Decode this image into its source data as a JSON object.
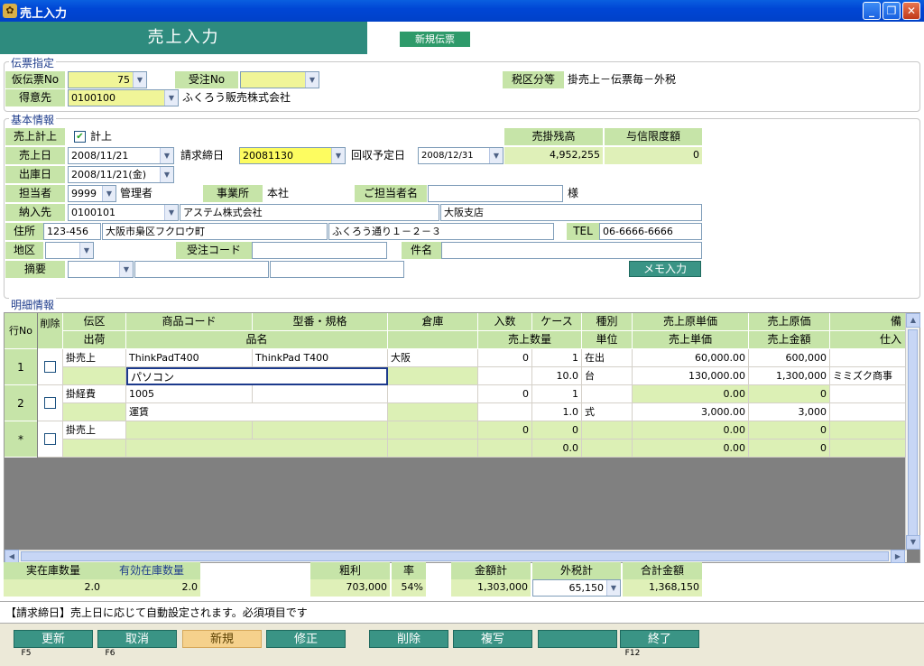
{
  "window": {
    "title": "売上入力"
  },
  "header": {
    "title": "売上入力",
    "new_slip": "新規伝票"
  },
  "slip": {
    "legend": "伝票指定",
    "temp_no_label": "仮伝票No",
    "temp_no": "75",
    "order_no_label": "受注No",
    "order_no": "",
    "tax_label": "税区分等",
    "tax_value": "掛売上－伝票毎－外税",
    "customer_label": "得意先",
    "customer_code": "0100100",
    "customer_name": "ふくろう販売株式会社"
  },
  "basic": {
    "legend": "基本情報",
    "sales_record_label": "売上計上",
    "sales_record_check": "計上",
    "sales_date_label": "売上日",
    "sales_date": "2008/11/21",
    "billing_date_label": "請求締日",
    "billing_date": "20081130",
    "collect_label": "回収予定日",
    "collect_date": "2008/12/31",
    "balance_label": "売掛残高",
    "balance": "4,952,255",
    "credit_label": "与信限度額",
    "credit": "0",
    "ship_date_label": "出庫日",
    "ship_date": "2008/11/21(金)",
    "staff_label": "担当者",
    "staff_code": "9999",
    "staff_name": "管理者",
    "office_label": "事業所",
    "office": "本社",
    "contact_label": "ご担当者名",
    "contact": "",
    "honorific": "様",
    "delivery_label": "納入先",
    "delivery_code": "0100101",
    "delivery_name": "アステム株式会社",
    "delivery_branch": "大阪支店",
    "address_label": "住所",
    "zip": "123-456",
    "addr1": "大阪市梟区フクロウ町",
    "addr2": "ふくろう通り１－２－３",
    "tel_label": "TEL",
    "tel": "06-6666-6666",
    "area_label": "地区",
    "area": "",
    "order_code_label": "受注コード",
    "order_code": "",
    "subject_label": "件名",
    "subject": "",
    "memo_label": "摘要",
    "memo_button": "メモ入力"
  },
  "detail": {
    "legend": "明細情報",
    "headers1": [
      "行No",
      "削除",
      "伝区",
      "商品コード",
      "型番・規格",
      "倉庫",
      "入数",
      "ケース",
      "種別",
      "売上原単価",
      "売上原価",
      "備"
    ],
    "headers2": [
      "出荷",
      "品名",
      "売上数量",
      "単位",
      "売上単価",
      "売上金額",
      "仕入"
    ],
    "rows": [
      {
        "no": "1",
        "kubun": "掛売上",
        "code": "ThinkPadT400",
        "model": "ThinkPad T400",
        "warehouse": "大阪",
        "irisu": "0",
        "case": "1",
        "kind": "在出",
        "unit_cost": "60,000.00",
        "cost": "600,000",
        "note": "",
        "name": "パソコン",
        "qty": "10.0",
        "unit": "台",
        "unit_price": "130,000.00",
        "amount": "1,300,000",
        "supplier": "ミミズク商事"
      },
      {
        "no": "2",
        "kubun": "掛経費",
        "code": "1005",
        "model": "",
        "warehouse": "",
        "irisu": "0",
        "case": "1",
        "kind": "",
        "unit_cost": "0.00",
        "cost": "0",
        "note": "",
        "name": "運賃",
        "qty": "1.0",
        "unit": "式",
        "unit_price": "3,000.00",
        "amount": "3,000",
        "supplier": ""
      },
      {
        "no": "*",
        "kubun": "掛売上",
        "code": "",
        "model": "",
        "warehouse": "",
        "irisu": "0",
        "case": "0",
        "kind": "",
        "unit_cost": "0.00",
        "cost": "0",
        "note": "",
        "name": "",
        "qty": "0.0",
        "unit": "",
        "unit_price": "0.00",
        "amount": "0",
        "supplier": ""
      }
    ]
  },
  "totals": {
    "stock_label": "実在庫数量",
    "stock": "2.0",
    "avail_label": "有効在庫数量",
    "avail": "2.0",
    "profit_label": "粗利",
    "profit": "703,000",
    "rate_label": "率",
    "rate": "54%",
    "amount_label": "金額計",
    "amount": "1,303,000",
    "tax_label": "外税計",
    "tax": "65,150",
    "total_label": "合計金額",
    "total": "1,368,150"
  },
  "status": "【請求締日】売上日に応じて自動設定されます。必須項目です",
  "fbuttons": [
    {
      "label": "更新",
      "key": "F5"
    },
    {
      "label": "取消",
      "key": "F6"
    },
    {
      "label": "新規",
      "key": ""
    },
    {
      "label": "修正",
      "key": ""
    },
    {
      "label": "削除",
      "key": ""
    },
    {
      "label": "複写",
      "key": ""
    },
    {
      "label": "",
      "key": ""
    },
    {
      "label": "終了",
      "key": "F12"
    }
  ]
}
